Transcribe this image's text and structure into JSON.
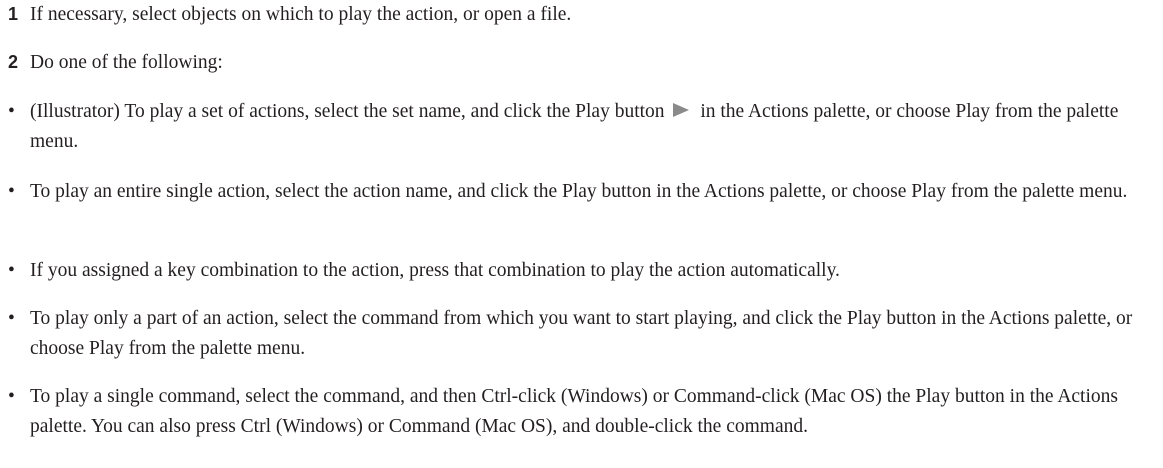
{
  "steps": [
    {
      "number": "1",
      "text": "If necessary, select objects on which to play the action, or open a file."
    },
    {
      "number": "2",
      "text": "Do one of the following:"
    }
  ],
  "bullets": [
    {
      "marker": "•",
      "text_before_icon": "(Illustrator) To play a set of actions, select the set name, and click the Play button",
      "icon": "play-triangle-icon",
      "text_after_icon": "in the Actions palette, or choose Play from the palette menu."
    },
    {
      "marker": "•",
      "text": "To play an entire single action, select the action name, and click the Play button in the Actions palette, or choose Play from the palette menu."
    },
    {
      "marker": "•",
      "text": "If you assigned a key combination to the action, press that combination to play the action automatically."
    },
    {
      "marker": "•",
      "text": "To play only a part of an action, select the command from which you want to start playing, and click the Play button in the Actions palette, or choose Play from the palette menu."
    },
    {
      "marker": "•",
      "text": "To play a single command, select the command, and then Ctrl-click (Windows) or Command-click (Mac OS) the Play button in the Actions palette. You can also press Ctrl (Windows) or Command (Mac OS), and double-click the command."
    }
  ],
  "colors": {
    "text": "#231f20",
    "icon": "#8a8a8a"
  }
}
